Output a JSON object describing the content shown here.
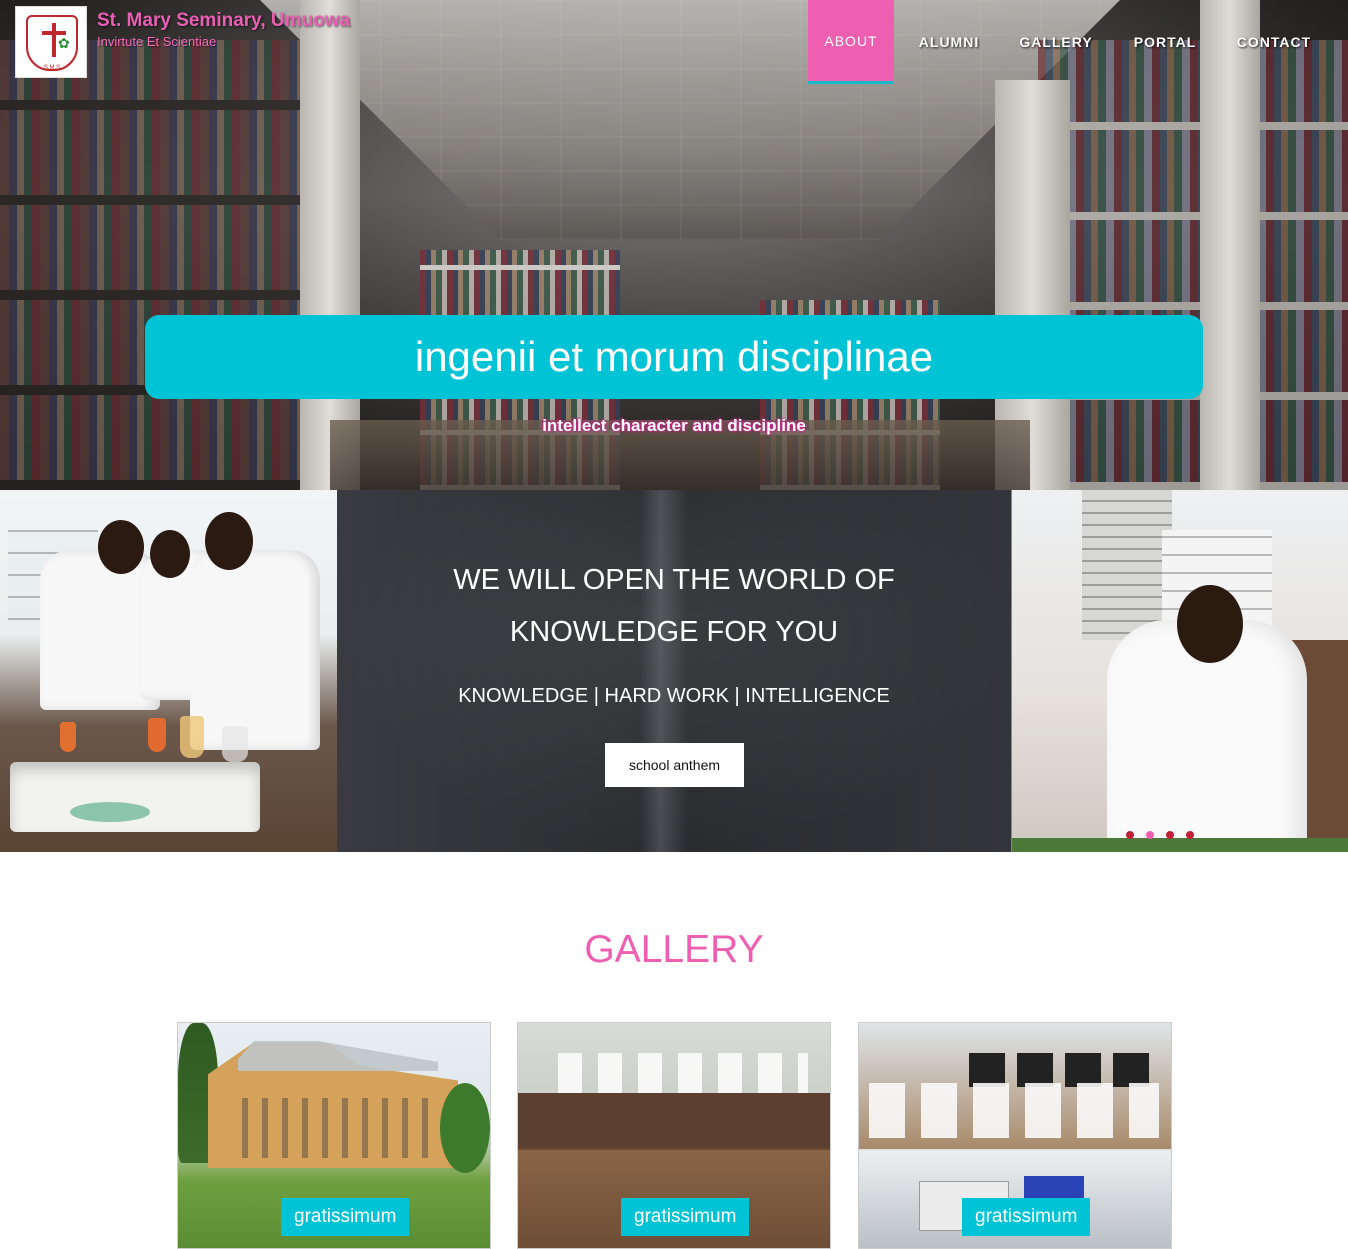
{
  "brand": {
    "title": "St. Mary Seminary, Umuowa",
    "motto": "Invirtute Et Scientiae",
    "logo_text": "S.M.S"
  },
  "nav": {
    "items": [
      {
        "label": "ABOUT",
        "active": true
      },
      {
        "label": "ALUMNI",
        "active": false
      },
      {
        "label": "GALLERY",
        "active": false
      },
      {
        "label": "PORTAL",
        "active": false
      },
      {
        "label": "CONTACT",
        "active": false
      }
    ]
  },
  "hero": {
    "tagline": "ingenii et morum disciplinae",
    "subtagline": "intellect character and discipline"
  },
  "slider": {
    "heading_line1": "WE WILL OPEN THE WORLD OF",
    "heading_line2": "KNOWLEDGE FOR YOU",
    "subheading": "KNOWLEDGE | HARD WORK | INTELLIGENCE",
    "button_label": "school anthem",
    "dots": 4,
    "active_dot": 2
  },
  "gallery": {
    "title": "GALLERY",
    "items": [
      {
        "caption": "gratissimum"
      },
      {
        "caption": "gratissimum"
      },
      {
        "caption": "gratissimum"
      }
    ]
  },
  "colors": {
    "accent_pink": "#ef5fb1",
    "accent_cyan": "#00c4d6"
  }
}
